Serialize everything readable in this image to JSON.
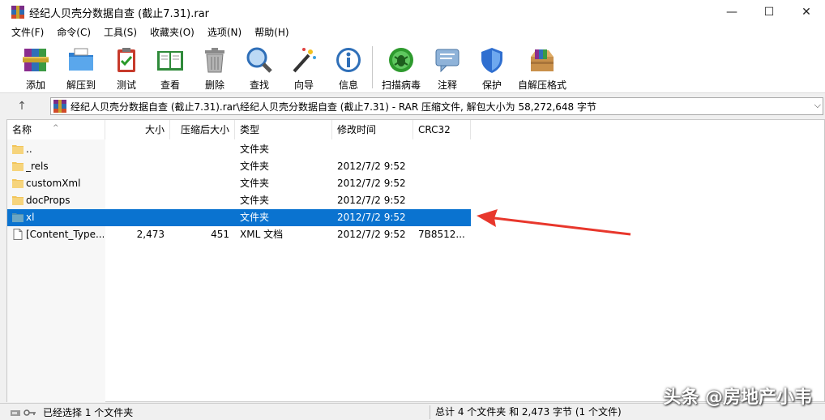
{
  "window": {
    "title": "经纪人贝壳分数据自查 (截止7.31).rar",
    "minimize": "—",
    "maximize": "☐",
    "close": "✕"
  },
  "menu": [
    "文件(F)",
    "命令(C)",
    "工具(S)",
    "收藏夹(O)",
    "选项(N)",
    "帮助(H)"
  ],
  "toolbar": [
    {
      "label": "添加",
      "icon": "add-archive-icon"
    },
    {
      "label": "解压到",
      "icon": "extract-to-folder-icon"
    },
    {
      "label": "测试",
      "icon": "test-clipboard-icon"
    },
    {
      "label": "查看",
      "icon": "view-book-icon"
    },
    {
      "label": "删除",
      "icon": "trash-bin-icon"
    },
    {
      "label": "查找",
      "icon": "find-magnifier-icon"
    },
    {
      "label": "向导",
      "icon": "wizard-wand-icon"
    },
    {
      "label": "信息",
      "icon": "info-icon"
    },
    {
      "label": "扫描病毒",
      "icon": "virus-scan-icon"
    },
    {
      "label": "注释",
      "icon": "comment-icon"
    },
    {
      "label": "保护",
      "icon": "shield-icon"
    },
    {
      "label": "自解压格式",
      "icon": "sfx-box-icon"
    }
  ],
  "address": {
    "up": "↑",
    "path": "经纪人贝壳分数据自查 (截止7.31).rar\\经纪人贝壳分数据自查 (截止7.31) - RAR 压缩文件, 解包大小为 58,272,648 字节",
    "dropdown": "⌵"
  },
  "columns": [
    "名称",
    "大小",
    "压缩后大小",
    "类型",
    "修改时间",
    "CRC32"
  ],
  "sort_indicator": "^",
  "files": [
    {
      "name": "..",
      "size": "",
      "packed": "",
      "type": "文件夹",
      "modified": "",
      "crc": "",
      "kind": "folder",
      "selected": false
    },
    {
      "name": "_rels",
      "size": "",
      "packed": "",
      "type": "文件夹",
      "modified": "2012/7/2 9:52",
      "crc": "",
      "kind": "folder",
      "selected": false
    },
    {
      "name": "customXml",
      "size": "",
      "packed": "",
      "type": "文件夹",
      "modified": "2012/7/2 9:52",
      "crc": "",
      "kind": "folder",
      "selected": false
    },
    {
      "name": "docProps",
      "size": "",
      "packed": "",
      "type": "文件夹",
      "modified": "2012/7/2 9:52",
      "crc": "",
      "kind": "folder",
      "selected": false
    },
    {
      "name": "xl",
      "size": "",
      "packed": "",
      "type": "文件夹",
      "modified": "2012/7/2 9:52",
      "crc": "",
      "kind": "folder",
      "selected": true
    },
    {
      "name": "[Content_Type...",
      "size": "2,473",
      "packed": "451",
      "type": "XML 文档",
      "modified": "2012/7/2 9:52",
      "crc": "7B8512...",
      "kind": "file",
      "selected": false
    }
  ],
  "status": {
    "left": "已经选择 1 个文件夹",
    "right": "总计 4 个文件夹 和 2,473 字节 (1 个文件)"
  },
  "watermark": "头条 @房地产小韦",
  "colors": {
    "selection": "#0a73d0",
    "folder": "#f2c55c",
    "annotation_arrow": "#e8372c"
  }
}
